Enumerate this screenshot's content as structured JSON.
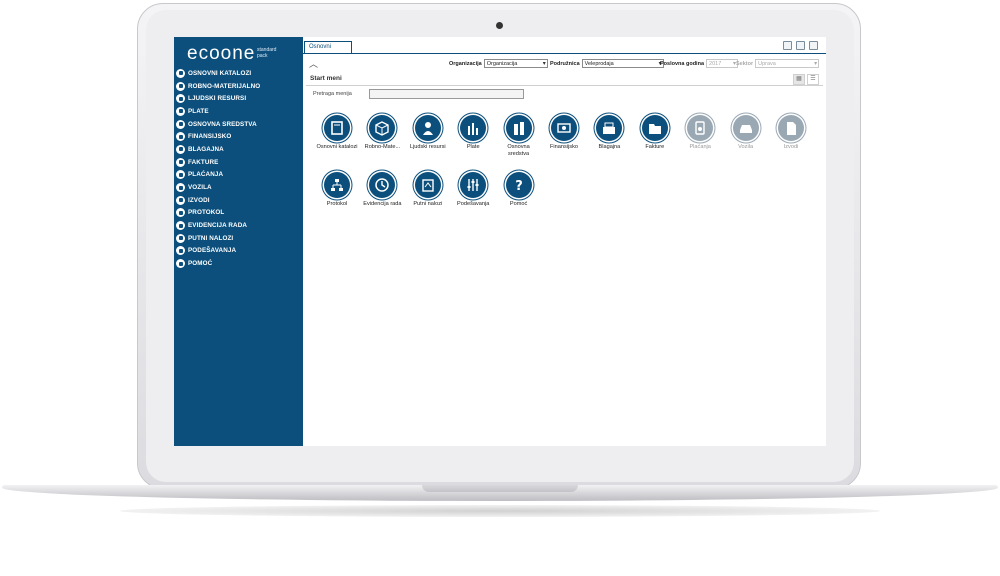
{
  "app": {
    "logo": "ecoone",
    "logo_sub": "standard pack"
  },
  "sidebar": {
    "items": [
      {
        "label": "OSNOVNI KATALOZI",
        "icon": "catalog-icon"
      },
      {
        "label": "ROBNO-MATERIJALNO",
        "icon": "box-icon"
      },
      {
        "label": "LJUDSKI RESURSI",
        "icon": "person-icon"
      },
      {
        "label": "PLATE",
        "icon": "bars-icon"
      },
      {
        "label": "OSNOVNA SREDSTVA",
        "icon": "assets-icon"
      },
      {
        "label": "FINANSIJSKO",
        "icon": "money-icon"
      },
      {
        "label": "BLAGAJNA",
        "icon": "register-icon"
      },
      {
        "label": "FAKTURE",
        "icon": "folder-icon"
      },
      {
        "label": "PLAĆANJA",
        "icon": "payment-icon"
      },
      {
        "label": "VOZILA",
        "icon": "car-icon"
      },
      {
        "label": "IZVODI",
        "icon": "document-icon"
      },
      {
        "label": "PROTOKOL",
        "icon": "flow-icon"
      },
      {
        "label": "EVIDENCIJA RADA",
        "icon": "clock-icon"
      },
      {
        "label": "PUTNI NALOZI",
        "icon": "travel-icon"
      },
      {
        "label": "PODEŠAVANJA",
        "icon": "sliders-icon"
      },
      {
        "label": "POMOĆ",
        "icon": "help-icon"
      }
    ]
  },
  "tabs": [
    {
      "label": "Osnovni"
    }
  ],
  "toolbar": {
    "organizacija_label": "Organizacija",
    "organizacija_value": "Organizacija",
    "podruznica_label": "Podružnica",
    "podruznica_value": "Veleprodaja",
    "godina_label": "Poslovna godina",
    "godina_value": "2017",
    "sektor_label": "Sektor",
    "sektor_value": "Uprava"
  },
  "start": {
    "title": "Start meni",
    "search_label": "Pretraga menija",
    "search_value": ""
  },
  "tiles": [
    {
      "label": "Osnovni katalozi",
      "icon": "catalog-icon",
      "enabled": true
    },
    {
      "label": "Robno-Mate...",
      "icon": "box-icon",
      "enabled": true
    },
    {
      "label": "Ljudski resursi",
      "icon": "person-icon",
      "enabled": true
    },
    {
      "label": "Plate",
      "icon": "bars-icon",
      "enabled": true
    },
    {
      "label": "Osnovna sredstva",
      "icon": "assets-icon",
      "enabled": true
    },
    {
      "label": "Finansijsko",
      "icon": "money-icon",
      "enabled": true
    },
    {
      "label": "Blagajna",
      "icon": "register-icon",
      "enabled": true
    },
    {
      "label": "Fakture",
      "icon": "folder-icon",
      "enabled": true
    },
    {
      "label": "Plaćanja",
      "icon": "payment-icon",
      "enabled": false
    },
    {
      "label": "Vozila",
      "icon": "car-icon",
      "enabled": false
    },
    {
      "label": "Izvodi",
      "icon": "document-icon",
      "enabled": false
    },
    {
      "label": "Protokol",
      "icon": "flow-icon",
      "enabled": true
    },
    {
      "label": "Evidencija rada",
      "icon": "clock-icon",
      "enabled": true
    },
    {
      "label": "Putni nalozi",
      "icon": "travel-icon",
      "enabled": true
    },
    {
      "label": "Podešavanja",
      "icon": "sliders-icon",
      "enabled": true
    },
    {
      "label": "Pomoć",
      "icon": "help-icon",
      "enabled": true
    }
  ],
  "colors": {
    "brand": "#0c4f7c",
    "disabled": "#9aa8b4"
  }
}
